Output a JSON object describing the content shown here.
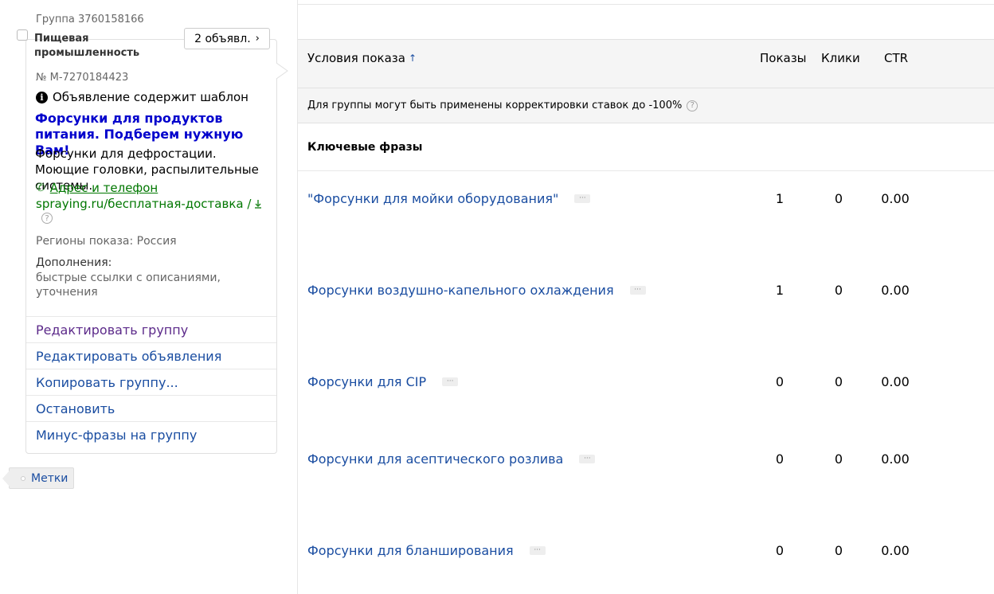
{
  "group": {
    "id_label": "Группа 3760158166",
    "name": "Пищевая промышленность",
    "ads_button": "2 объявл."
  },
  "ad": {
    "number": "№ M-7270184423",
    "template_notice": "Объявление содержит шаблон",
    "title": "Форсунки для продуктов питания. Подберем нужную Вам!",
    "text": "Форсунки для дефростации. Моющие головки, распылительные системы.",
    "contact_link": "Адрес и телефон",
    "display_url": "spraying.ru/бесплатная-доставка /",
    "regions": "Регионы показа: Россия",
    "extras_label": "Дополнения:",
    "extras_text": "быстрые ссылки с описаниями, уточнения"
  },
  "actions": [
    {
      "label": "Редактировать группу"
    },
    {
      "label": "Редактировать объявления"
    },
    {
      "label": "Копировать группу..."
    },
    {
      "label": "Остановить"
    },
    {
      "label": "Минус-фразы на группу"
    }
  ],
  "tags_button": "Метки",
  "table": {
    "headers": {
      "conditions": "Условия показа",
      "shows": "Показы",
      "clicks": "Клики",
      "ctr": "CTR"
    },
    "adjustment_note": "Для группы могут быть применены корректировки ставок до -100%",
    "section_title": "Ключевые фразы",
    "rows": [
      {
        "phrase": "\"Форсунки для мойки оборудования\"",
        "shows": "1",
        "clicks": "0",
        "ctr": "0.00"
      },
      {
        "phrase": "Форсунки воздушно-капельного охлаждения",
        "shows": "1",
        "clicks": "0",
        "ctr": "0.00"
      },
      {
        "phrase": "Форсунки для CIP",
        "shows": "0",
        "clicks": "0",
        "ctr": "0.00"
      },
      {
        "phrase": "Форсунки для асептического розлива",
        "shows": "0",
        "clicks": "0",
        "ctr": "0.00"
      },
      {
        "phrase": "Форсунки для бланширования",
        "shows": "0",
        "clicks": "0",
        "ctr": "0.00"
      }
    ]
  }
}
